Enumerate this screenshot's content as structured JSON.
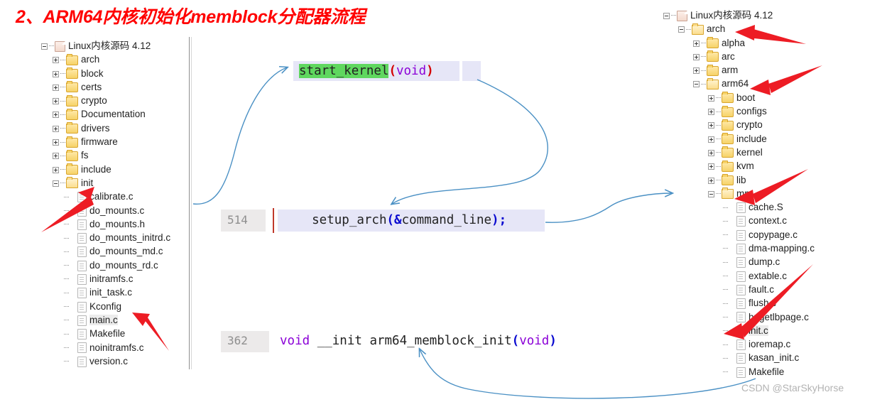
{
  "title": "2、ARM64内核初始化memblock分配器流程",
  "colors": {
    "title_red": "#FF0000",
    "arrow_red": "#ED1C24",
    "arrow_blue": "#4A90C4",
    "highlight_green": "#5FD75F",
    "code_bg": "#E6E6F7",
    "gutter_bg": "#ECEAEA",
    "keyword_purple": "#8B00D7",
    "punct_blue": "#0A0AD0",
    "paren_red": "#D40000",
    "watermark_gray": "#B3B3B3"
  },
  "left_tree": {
    "name": "linux-kernel-source-tree-left",
    "nodes": [
      {
        "label": "Linux内核源码 4.12",
        "depth": 0,
        "icon": "root-icon",
        "state": "expanded",
        "kind": "root"
      },
      {
        "label": "arch",
        "depth": 1,
        "icon": "folder-icon",
        "state": "collapsed",
        "kind": "folder"
      },
      {
        "label": "block",
        "depth": 1,
        "icon": "folder-icon",
        "state": "collapsed",
        "kind": "folder"
      },
      {
        "label": "certs",
        "depth": 1,
        "icon": "folder-icon",
        "state": "collapsed",
        "kind": "folder"
      },
      {
        "label": "crypto",
        "depth": 1,
        "icon": "folder-icon",
        "state": "collapsed",
        "kind": "folder"
      },
      {
        "label": "Documentation",
        "depth": 1,
        "icon": "folder-icon",
        "state": "collapsed",
        "kind": "folder"
      },
      {
        "label": "drivers",
        "depth": 1,
        "icon": "folder-icon",
        "state": "collapsed",
        "kind": "folder"
      },
      {
        "label": "firmware",
        "depth": 1,
        "icon": "folder-icon",
        "state": "collapsed",
        "kind": "folder"
      },
      {
        "label": "fs",
        "depth": 1,
        "icon": "folder-icon",
        "state": "collapsed",
        "kind": "folder"
      },
      {
        "label": "include",
        "depth": 1,
        "icon": "folder-icon",
        "state": "collapsed",
        "kind": "folder"
      },
      {
        "label": "init",
        "depth": 1,
        "icon": "folder-open-icon",
        "state": "expanded",
        "kind": "folder"
      },
      {
        "label": "calibrate.c",
        "depth": 2,
        "icon": "file-icon",
        "state": "leaf",
        "kind": "file"
      },
      {
        "label": "do_mounts.c",
        "depth": 2,
        "icon": "file-icon",
        "state": "leaf",
        "kind": "file"
      },
      {
        "label": "do_mounts.h",
        "depth": 2,
        "icon": "file-icon",
        "state": "leaf",
        "kind": "file"
      },
      {
        "label": "do_mounts_initrd.c",
        "depth": 2,
        "icon": "file-icon",
        "state": "leaf",
        "kind": "file"
      },
      {
        "label": "do_mounts_md.c",
        "depth": 2,
        "icon": "file-icon",
        "state": "leaf",
        "kind": "file"
      },
      {
        "label": "do_mounts_rd.c",
        "depth": 2,
        "icon": "file-icon",
        "state": "leaf",
        "kind": "file"
      },
      {
        "label": "initramfs.c",
        "depth": 2,
        "icon": "file-icon",
        "state": "leaf",
        "kind": "file"
      },
      {
        "label": "init_task.c",
        "depth": 2,
        "icon": "file-icon",
        "state": "leaf",
        "kind": "file"
      },
      {
        "label": "Kconfig",
        "depth": 2,
        "icon": "file-icon",
        "state": "leaf",
        "kind": "file"
      },
      {
        "label": "main.c",
        "depth": 2,
        "icon": "file-icon",
        "state": "leaf",
        "kind": "file",
        "selected": true
      },
      {
        "label": "Makefile",
        "depth": 2,
        "icon": "file-icon",
        "state": "leaf",
        "kind": "file"
      },
      {
        "label": "noinitramfs.c",
        "depth": 2,
        "icon": "file-icon",
        "state": "leaf",
        "kind": "file"
      },
      {
        "label": "version.c",
        "depth": 2,
        "icon": "file-icon",
        "state": "leaf",
        "kind": "file"
      }
    ]
  },
  "right_tree": {
    "name": "linux-kernel-source-tree-right",
    "nodes": [
      {
        "label": "Linux内核源码 4.12",
        "depth": 0,
        "icon": "root-icon",
        "state": "expanded",
        "kind": "root"
      },
      {
        "label": "arch",
        "depth": 1,
        "icon": "folder-open-icon",
        "state": "expanded",
        "kind": "folder"
      },
      {
        "label": "alpha",
        "depth": 2,
        "icon": "folder-icon",
        "state": "collapsed",
        "kind": "folder"
      },
      {
        "label": "arc",
        "depth": 2,
        "icon": "folder-icon",
        "state": "collapsed",
        "kind": "folder"
      },
      {
        "label": "arm",
        "depth": 2,
        "icon": "folder-icon",
        "state": "collapsed",
        "kind": "folder"
      },
      {
        "label": "arm64",
        "depth": 2,
        "icon": "folder-open-icon",
        "state": "expanded",
        "kind": "folder"
      },
      {
        "label": "boot",
        "depth": 3,
        "icon": "folder-icon",
        "state": "collapsed",
        "kind": "folder"
      },
      {
        "label": "configs",
        "depth": 3,
        "icon": "folder-icon",
        "state": "collapsed",
        "kind": "folder"
      },
      {
        "label": "crypto",
        "depth": 3,
        "icon": "folder-icon",
        "state": "collapsed",
        "kind": "folder"
      },
      {
        "label": "include",
        "depth": 3,
        "icon": "folder-icon",
        "state": "collapsed",
        "kind": "folder"
      },
      {
        "label": "kernel",
        "depth": 3,
        "icon": "folder-icon",
        "state": "collapsed",
        "kind": "folder"
      },
      {
        "label": "kvm",
        "depth": 3,
        "icon": "folder-icon",
        "state": "collapsed",
        "kind": "folder"
      },
      {
        "label": "lib",
        "depth": 3,
        "icon": "folder-icon",
        "state": "collapsed",
        "kind": "folder"
      },
      {
        "label": "mm",
        "depth": 3,
        "icon": "folder-open-icon",
        "state": "expanded",
        "kind": "folder"
      },
      {
        "label": "cache.S",
        "depth": 4,
        "icon": "file-icon",
        "state": "leaf",
        "kind": "file"
      },
      {
        "label": "context.c",
        "depth": 4,
        "icon": "file-icon",
        "state": "leaf",
        "kind": "file"
      },
      {
        "label": "copypage.c",
        "depth": 4,
        "icon": "file-icon",
        "state": "leaf",
        "kind": "file"
      },
      {
        "label": "dma-mapping.c",
        "depth": 4,
        "icon": "file-icon",
        "state": "leaf",
        "kind": "file"
      },
      {
        "label": "dump.c",
        "depth": 4,
        "icon": "file-icon",
        "state": "leaf",
        "kind": "file"
      },
      {
        "label": "extable.c",
        "depth": 4,
        "icon": "file-icon",
        "state": "leaf",
        "kind": "file"
      },
      {
        "label": "fault.c",
        "depth": 4,
        "icon": "file-icon",
        "state": "leaf",
        "kind": "file"
      },
      {
        "label": "flush.c",
        "depth": 4,
        "icon": "file-icon",
        "state": "leaf",
        "kind": "file"
      },
      {
        "label": "hugetlbpage.c",
        "depth": 4,
        "icon": "file-icon",
        "state": "leaf",
        "kind": "file"
      },
      {
        "label": "init.c",
        "depth": 4,
        "icon": "file-icon",
        "state": "leaf",
        "kind": "file",
        "selected": true
      },
      {
        "label": "ioremap.c",
        "depth": 4,
        "icon": "file-icon",
        "state": "leaf",
        "kind": "file"
      },
      {
        "label": "kasan_init.c",
        "depth": 4,
        "icon": "file-icon",
        "state": "leaf",
        "kind": "file"
      },
      {
        "label": "Makefile",
        "depth": 4,
        "icon": "file-icon",
        "state": "leaf",
        "kind": "file"
      }
    ]
  },
  "code_blocks": [
    {
      "name": "code-start-kernel",
      "line_number": "",
      "tokens": [
        {
          "text": "start_kernel",
          "style": "highlight"
        },
        {
          "text": "(",
          "style": "paren-red"
        },
        {
          "text": "void",
          "style": "keyword"
        },
        {
          "text": ")",
          "style": "paren-red"
        }
      ],
      "plain": "start_kernel(void)"
    },
    {
      "name": "code-setup-arch",
      "line_number": "514",
      "tokens": [
        {
          "text": "    setup_arch",
          "style": "plain"
        },
        {
          "text": "(&",
          "style": "punct"
        },
        {
          "text": "command_line",
          "style": "plain"
        },
        {
          "text": ");",
          "style": "punct"
        }
      ],
      "plain": "    setup_arch(&command_line);"
    },
    {
      "name": "code-arm64-memblock-init",
      "line_number": "362",
      "tokens": [
        {
          "text": "void",
          "style": "keyword"
        },
        {
          "text": " __init arm64_memblock_init",
          "style": "plain"
        },
        {
          "text": "(",
          "style": "punct"
        },
        {
          "text": "void",
          "style": "keyword"
        },
        {
          "text": ")",
          "style": "punct"
        }
      ],
      "plain": "void __init arm64_memblock_init(void)"
    }
  ],
  "annotations": {
    "red_arrows": [
      {
        "name": "red-arrow-init",
        "target": "init"
      },
      {
        "name": "red-arrow-main-c",
        "target": "main.c"
      },
      {
        "name": "red-arrow-arch",
        "target": "arch"
      },
      {
        "name": "red-arrow-arm64",
        "target": "arm64"
      },
      {
        "name": "red-arrow-mm",
        "target": "mm"
      },
      {
        "name": "red-arrow-init-c",
        "target": "init.c"
      }
    ],
    "blue_arrows": [
      {
        "name": "blue-arrow-main-to-start-kernel",
        "from": "main.c",
        "to": "start_kernel(void)"
      },
      {
        "name": "blue-arrow-start-kernel-to-setup-arch",
        "from": "start_kernel(void)",
        "to": "setup_arch(&command_line);"
      },
      {
        "name": "blue-arrow-setup-arch-to-arm64-mm",
        "from": "setup_arch(&command_line);",
        "to": "arch/arm64/mm"
      },
      {
        "name": "blue-arrow-init-c-to-memblock-init",
        "from": "init.c",
        "to": "arm64_memblock_init(void)"
      }
    ]
  },
  "watermark": "CSDN @StarSkyHorse"
}
